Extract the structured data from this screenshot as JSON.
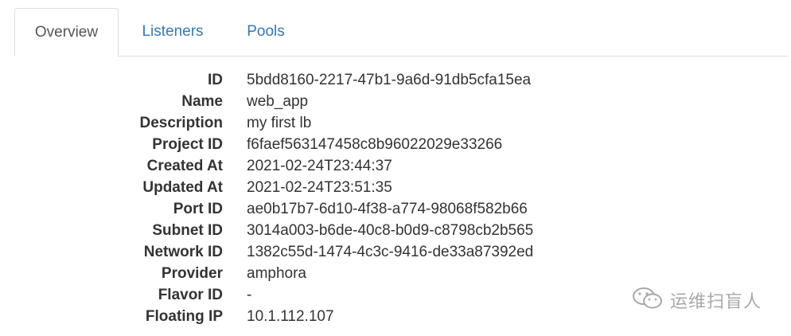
{
  "tabs": {
    "overview": "Overview",
    "listeners": "Listeners",
    "pools": "Pools"
  },
  "details": [
    {
      "label": "ID",
      "value": "5bdd8160-2217-47b1-9a6d-91db5cfa15ea"
    },
    {
      "label": "Name",
      "value": "web_app"
    },
    {
      "label": "Description",
      "value": "my first lb"
    },
    {
      "label": "Project ID",
      "value": "f6faef563147458c8b96022029e33266"
    },
    {
      "label": "Created At",
      "value": "2021-02-24T23:44:37"
    },
    {
      "label": "Updated At",
      "value": "2021-02-24T23:51:35"
    },
    {
      "label": "Port ID",
      "value": "ae0b17b7-6d10-4f38-a774-98068f582b66"
    },
    {
      "label": "Subnet ID",
      "value": "3014a003-b6de-40c8-b0d9-c8798cb2b565"
    },
    {
      "label": "Network ID",
      "value": "1382c55d-1474-4c3c-9416-de33a87392ed"
    },
    {
      "label": "Provider",
      "value": "amphora"
    },
    {
      "label": "Flavor ID",
      "value": "-"
    },
    {
      "label": "Floating IP",
      "value": "10.1.112.107"
    }
  ],
  "watermark": {
    "text": "运维扫盲人",
    "icon": "wechat-icon"
  }
}
